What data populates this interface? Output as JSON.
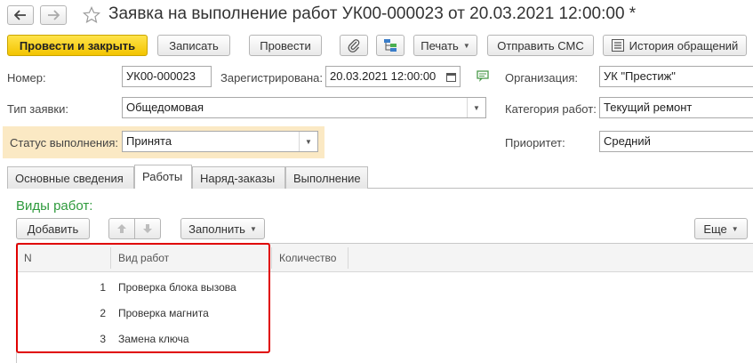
{
  "window": {
    "title": "Заявка на выполнение работ УК00-000023 от 20.03.2021 12:00:00 *"
  },
  "toolbar": {
    "post_close": "Провести и закрыть",
    "save": "Записать",
    "post": "Провести",
    "print": "Печать",
    "send_sms": "Отправить СМС",
    "history": "История обращений"
  },
  "form": {
    "number_label": "Номер:",
    "number_value": "УК00-000023",
    "registered_label": "Зарегистрирована:",
    "registered_value": "20.03.2021 12:00:00",
    "organization_label": "Организация:",
    "organization_value": "УК \"Престиж\"",
    "request_type_label": "Тип заявки:",
    "request_type_value": "Общедомовая",
    "work_category_label": "Категория работ:",
    "work_category_value": "Текущий ремонт",
    "status_label": "Статус выполнения:",
    "status_value": "Принята",
    "priority_label": "Приоритет:",
    "priority_value": "Средний"
  },
  "tabs": [
    {
      "label": "Основные сведения"
    },
    {
      "label": "Работы"
    },
    {
      "label": "Наряд-заказы"
    },
    {
      "label": "Выполнение"
    }
  ],
  "works": {
    "title": "Виды работ:",
    "add_button": "Добавить",
    "fill_button": "Заполнить",
    "more_button": "Еще",
    "columns": [
      "N",
      "Вид работ",
      "Количество"
    ],
    "rows": [
      {
        "n": "1",
        "work": "Проверка блока вызова",
        "qty": ""
      },
      {
        "n": "2",
        "work": "Проверка магнита",
        "qty": ""
      },
      {
        "n": "3",
        "work": "Замена ключа",
        "qty": ""
      }
    ]
  },
  "colors": {
    "primary_button": "#f3c400",
    "status_highlight": "#fbe9c4",
    "section_title": "#2e9a3c",
    "selection_frame": "#e00000"
  }
}
